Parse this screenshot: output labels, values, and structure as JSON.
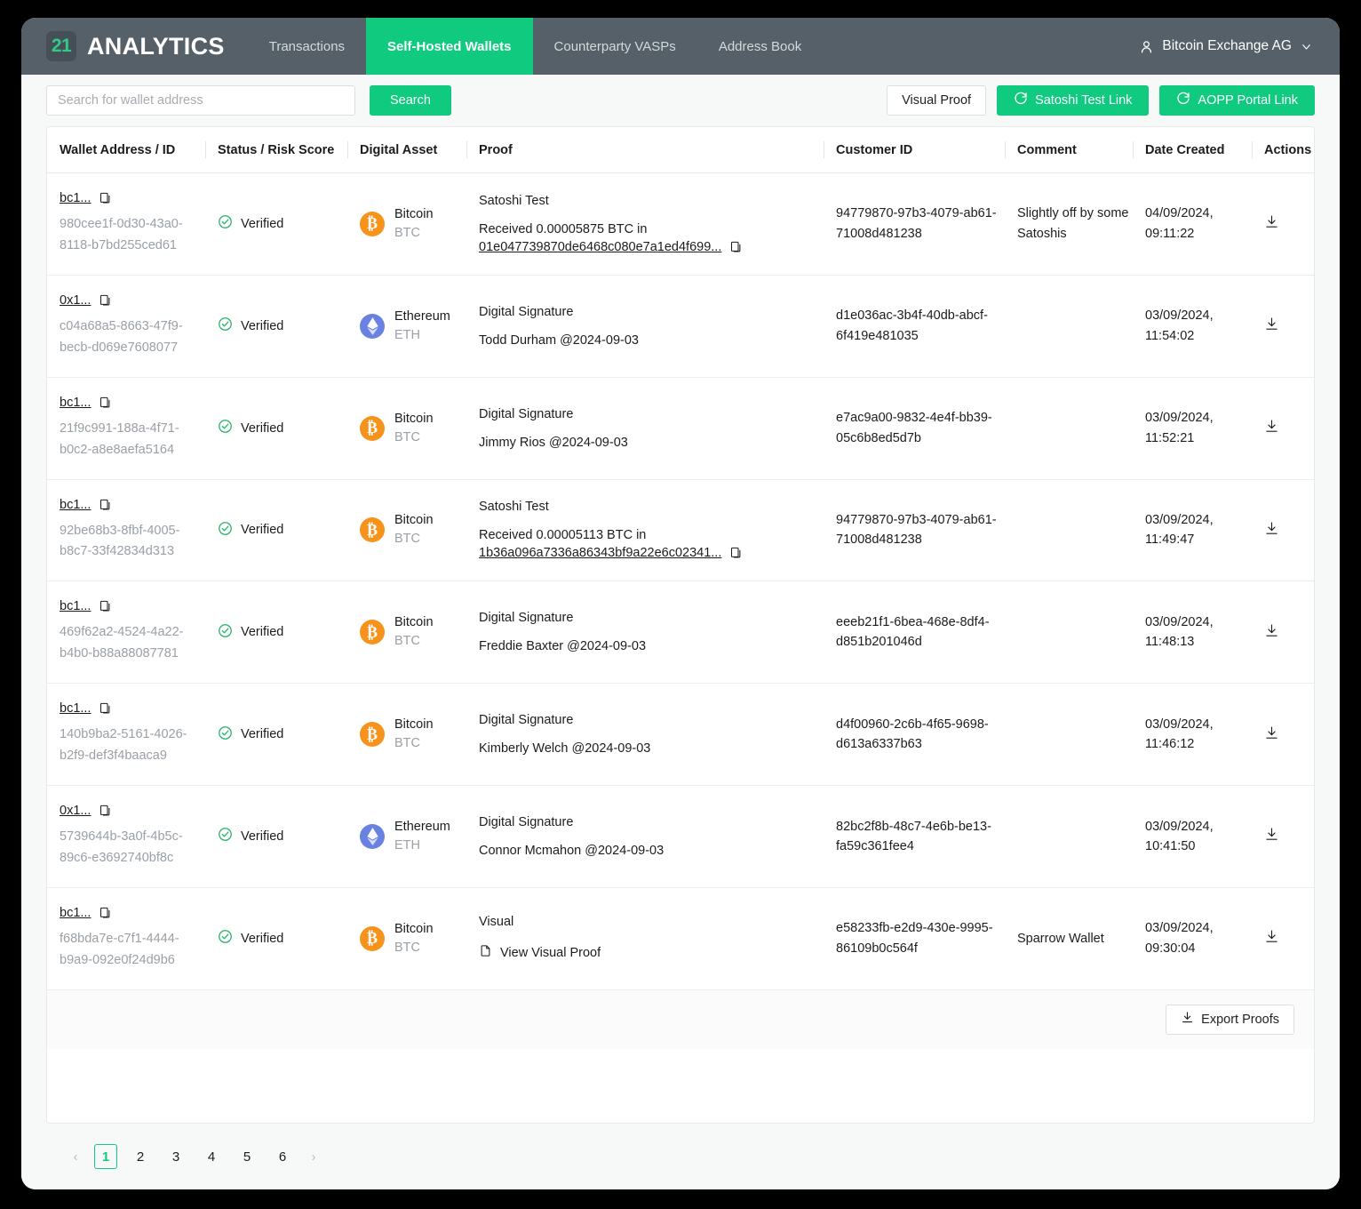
{
  "nav": {
    "logo_badge": "21",
    "logo_name": "ANALYTICS",
    "items": [
      {
        "label": "Transactions",
        "active": false
      },
      {
        "label": "Self-Hosted Wallets",
        "active": true
      },
      {
        "label": "Counterparty VASPs",
        "active": false
      },
      {
        "label": "Address Book",
        "active": false
      }
    ],
    "user": "Bitcoin Exchange AG"
  },
  "toolbar": {
    "search_placeholder": "Search for wallet address",
    "search_value": "",
    "search_button": "Search",
    "visual_proof_button": "Visual Proof",
    "satoshi_test_link_button": "Satoshi Test Link",
    "aopp_portal_link_button": "AOPP Portal Link"
  },
  "table": {
    "columns": [
      "Wallet Address / ID",
      "Status / Risk Score",
      "Digital Asset",
      "Proof",
      "Customer ID",
      "Comment",
      "Date Created",
      "Actions"
    ],
    "rows": [
      {
        "address": "bc1...",
        "wallet_id": "980cee1f-0d30-43a0-8118-b7bd255ced61",
        "status": "Verified",
        "asset_name": "Bitcoin",
        "asset_symbol": "BTC",
        "asset_icon": "bitcoin-icon",
        "proof_type": "Satoshi Test",
        "proof_detail": "Received 0.00005875 BTC in",
        "proof_tx": "01e047739870de6468c080e7a1ed4f699...",
        "customer_id": "94779870-97b3-4079-ab61-71008d481238",
        "comment": "Slightly off by some Satoshis",
        "date_created": "04/09/2024, 09:11:22"
      },
      {
        "address": "0x1...",
        "wallet_id": "c04a68a5-8663-47f9-becb-d069e7608077",
        "status": "Verified",
        "asset_name": "Ethereum",
        "asset_symbol": "ETH",
        "asset_icon": "ethereum-icon",
        "proof_type": "Digital Signature",
        "proof_detail": "Todd Durham @2024-09-03",
        "proof_tx": "",
        "customer_id": "d1e036ac-3b4f-40db-abcf-6f419e481035",
        "comment": "",
        "date_created": "03/09/2024, 11:54:02"
      },
      {
        "address": "bc1...",
        "wallet_id": "21f9c991-188a-4f71-b0c2-a8e8aefa5164",
        "status": "Verified",
        "asset_name": "Bitcoin",
        "asset_symbol": "BTC",
        "asset_icon": "bitcoin-icon",
        "proof_type": "Digital Signature",
        "proof_detail": "Jimmy Rios @2024-09-03",
        "proof_tx": "",
        "customer_id": "e7ac9a00-9832-4e4f-bb39-05c6b8ed5d7b",
        "comment": "",
        "date_created": "03/09/2024, 11:52:21"
      },
      {
        "address": "bc1...",
        "wallet_id": "92be68b3-8fbf-4005-b8c7-33f42834d313",
        "status": "Verified",
        "asset_name": "Bitcoin",
        "asset_symbol": "BTC",
        "asset_icon": "bitcoin-icon",
        "proof_type": "Satoshi Test",
        "proof_detail": "Received 0.00005113 BTC in",
        "proof_tx": "1b36a096a7336a86343bf9a22e6c02341...",
        "customer_id": "94779870-97b3-4079-ab61-71008d481238",
        "comment": "",
        "date_created": "03/09/2024, 11:49:47"
      },
      {
        "address": "bc1...",
        "wallet_id": "469f62a2-4524-4a22-b4b0-b88a88087781",
        "status": "Verified",
        "asset_name": "Bitcoin",
        "asset_symbol": "BTC",
        "asset_icon": "bitcoin-icon",
        "proof_type": "Digital Signature",
        "proof_detail": "Freddie Baxter @2024-09-03",
        "proof_tx": "",
        "customer_id": "eeeb21f1-6bea-468e-8df4-d851b201046d",
        "comment": "",
        "date_created": "03/09/2024, 11:48:13"
      },
      {
        "address": "bc1...",
        "wallet_id": "140b9ba2-5161-4026-b2f9-def3f4baaca9",
        "status": "Verified",
        "asset_name": "Bitcoin",
        "asset_symbol": "BTC",
        "asset_icon": "bitcoin-icon",
        "proof_type": "Digital Signature",
        "proof_detail": "Kimberly Welch @2024-09-03",
        "proof_tx": "",
        "customer_id": "d4f00960-2c6b-4f65-9698-d613a6337b63",
        "comment": "",
        "date_created": "03/09/2024, 11:46:12"
      },
      {
        "address": "0x1...",
        "wallet_id": "5739644b-3a0f-4b5c-89c6-e3692740bf8c",
        "status": "Verified",
        "asset_name": "Ethereum",
        "asset_symbol": "ETH",
        "asset_icon": "ethereum-icon",
        "proof_type": "Digital Signature",
        "proof_detail": "Connor Mcmahon @2024-09-03",
        "proof_tx": "",
        "customer_id": "82bc2f8b-48c7-4e6b-be13-fa59c361fee4",
        "comment": "",
        "date_created": "03/09/2024, 10:41:50"
      },
      {
        "address": "bc1...",
        "wallet_id": "f68bda7e-c7f1-4444-b9a9-092e0f24d9b6",
        "status": "Verified",
        "asset_name": "Bitcoin",
        "asset_symbol": "BTC",
        "asset_icon": "bitcoin-icon",
        "proof_type": "Visual",
        "proof_detail": "",
        "proof_visual_link": "View Visual Proof",
        "proof_tx": "",
        "customer_id": "e58233fb-e2d9-430e-9995-86109b0c564f",
        "comment": "Sparrow Wallet",
        "date_created": "03/09/2024, 09:30:04"
      }
    ]
  },
  "footer": {
    "export_button": "Export Proofs"
  },
  "pagination": {
    "prev": "‹",
    "next": "›",
    "pages": [
      "1",
      "2",
      "3",
      "4",
      "5",
      "6"
    ],
    "current": "1"
  },
  "colors": {
    "accent_green": "#0fca7f",
    "nav_bg": "#556068",
    "bitcoin_orange": "#f7931a",
    "ethereum_blue": "#6981e0",
    "verified_green": "#26b36a"
  }
}
